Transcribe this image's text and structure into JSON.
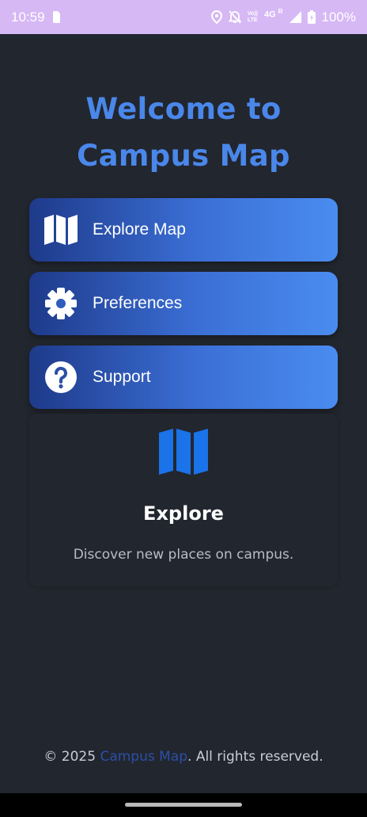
{
  "status_bar": {
    "time": "10:59",
    "volte_top": "Vo))",
    "volte_bottom": "LTE",
    "network": "4G",
    "roaming": "R",
    "battery": "100%"
  },
  "title": {
    "line1": "Welcome to",
    "line2": "Campus Map"
  },
  "menu": [
    {
      "label": "Explore Map",
      "icon": "map-icon"
    },
    {
      "label": "Preferences",
      "icon": "gear-icon"
    },
    {
      "label": "Support",
      "icon": "question-icon"
    }
  ],
  "card": {
    "icon": "map-icon",
    "title": "Explore",
    "description": "Discover new places on campus."
  },
  "footer": {
    "prefix": "© 2025 ",
    "brand": "Campus Map",
    "suffix": ". All rights reserved."
  },
  "colors": {
    "background": "#22262e",
    "accent": "#4a87ea",
    "button_gradient_start": "#1e3a8a",
    "button_gradient_end": "#4a8cf0",
    "card_icon": "#1a73e8",
    "footer_brand": "#2c4fa8",
    "status_bar": "#d6b8f5"
  }
}
